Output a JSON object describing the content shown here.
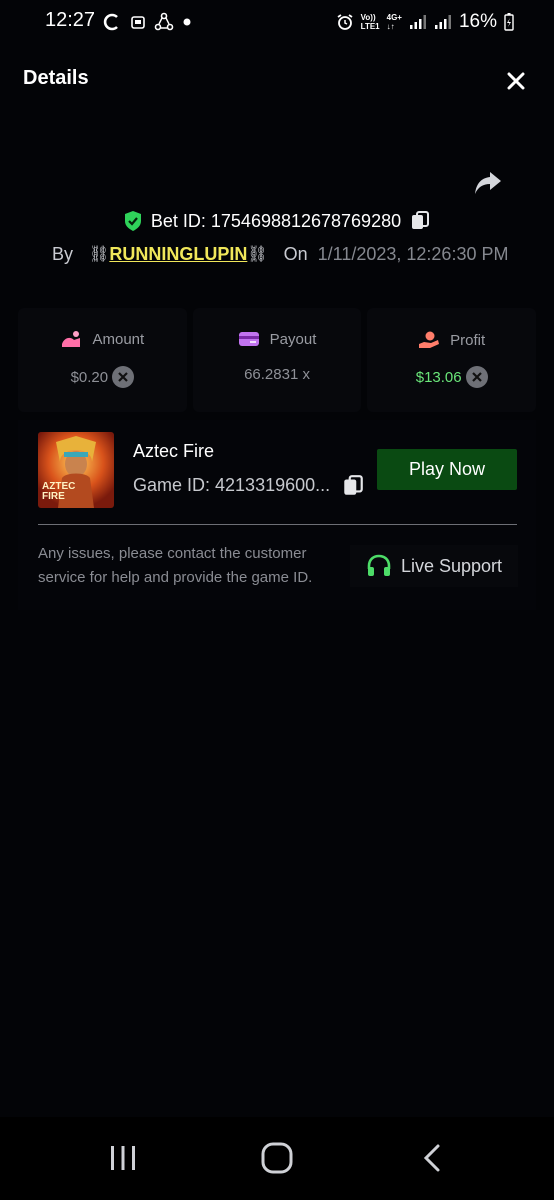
{
  "status_bar": {
    "time": "12:27",
    "battery": "16%",
    "network": "4G+",
    "carrier": "LTE1",
    "volte": "Vo))"
  },
  "header": {
    "title": "Details"
  },
  "bet": {
    "id_text": "Bet ID: 1754698812678769280",
    "by_label": "By",
    "user_chain_left": "⛓",
    "username": "RUNNINGLUPIN",
    "user_chain_right": "⛓",
    "on_label": "On",
    "date": "1/11/2023, 12:26:30 PM"
  },
  "stats": {
    "amount": {
      "label": "Amount",
      "value": "$0.20"
    },
    "payout": {
      "label": "Payout",
      "value": "66.2831 x"
    },
    "profit": {
      "label": "Profit",
      "value": "$13.06"
    }
  },
  "game": {
    "name": "Aztec Fire",
    "id_text": "Game ID: 4213319600...",
    "thumb_line1": "AZTEC",
    "thumb_line2": "FIRE",
    "play_label": "Play Now"
  },
  "support": {
    "help_text": "Any issues, please contact the customer service for help and provide the game ID.",
    "button_label": "Live Support"
  },
  "colors": {
    "accent_green": "#0a4a12",
    "profit_green": "#6ae67a",
    "username_yellow": "#f0e75a",
    "shield_green": "#2fd35a"
  }
}
